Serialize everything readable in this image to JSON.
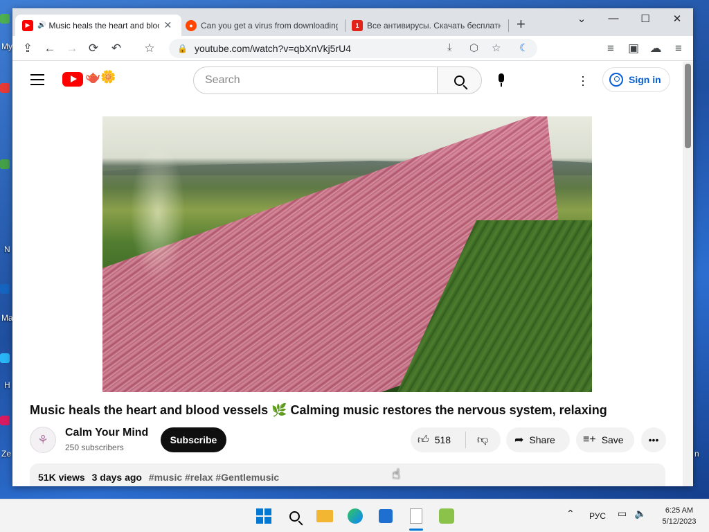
{
  "desktop": {
    "labels": [
      "My",
      "N",
      "Ma",
      "H",
      "Ze",
      "n"
    ]
  },
  "tabs": [
    {
      "title": "Music heals the heart and blood vessels",
      "favicon": "youtube-icon",
      "color": "#ff0000",
      "audio": "🔊"
    },
    {
      "title": "Can you get a virus from downloading",
      "favicon": "reddit-icon",
      "color": "#ff4500"
    },
    {
      "title": "Все антивирусы. Скачать бесплатно",
      "favicon": "site-icon",
      "color": "#e2231a"
    }
  ],
  "window_controls": {
    "dropdown": "⌄",
    "minimize": "—",
    "maximize": "☐",
    "close": "✕"
  },
  "toolbar": {
    "url": "youtube.com/watch?v=qbXnVkj5rU4"
  },
  "youtube": {
    "search_placeholder": "Search",
    "signin_label": "Sign in",
    "video_title": "Music heals the heart and blood vessels 🌿 Calming music restores the nervous system, relaxing",
    "channel_name": "Calm Your Mind",
    "subscribers": "250 subscribers",
    "subscribe_label": "Subscribe",
    "likes": "518",
    "share_label": "Share",
    "save_label": "Save",
    "views": "51K views",
    "age": "3 days ago",
    "tags": "#music #relax #Gentlemusic",
    "brand_color": "#ff0000",
    "link_color": "#065fd4"
  },
  "taskbar": {
    "language": "РУС",
    "time": "6:25 AM",
    "date": "5/12/2023"
  }
}
